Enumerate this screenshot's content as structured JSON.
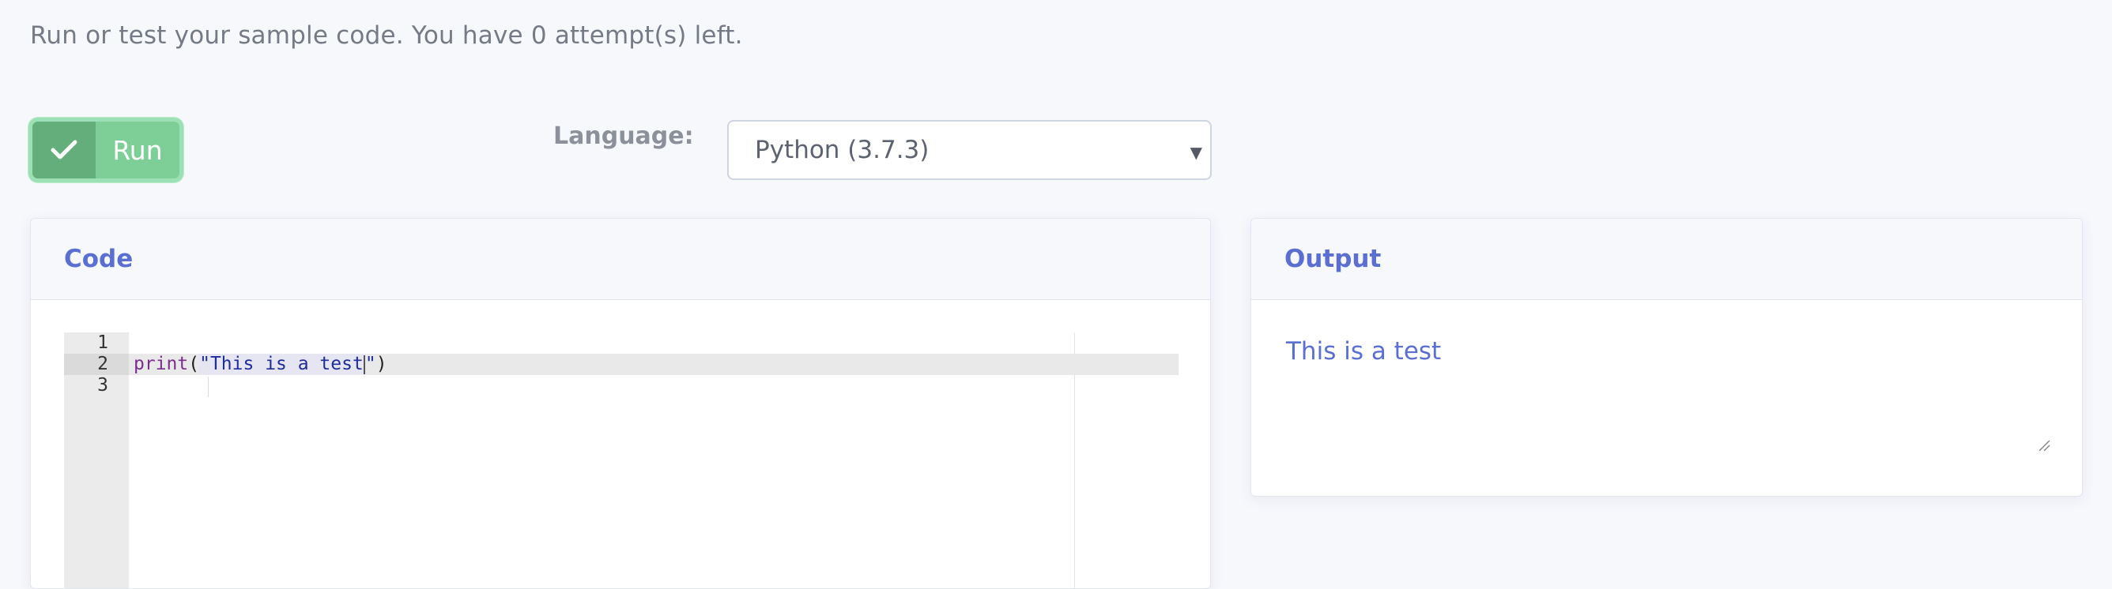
{
  "info": {
    "text": "Run or test your sample code. You have 0 attempt(s) left."
  },
  "toolbar": {
    "run_label": "Run",
    "language_label": "Language:",
    "language_selected": "Python (3.7.3)"
  },
  "code_panel": {
    "title": "Code",
    "line_numbers": [
      "1",
      "2",
      "3"
    ],
    "line2": {
      "func": "print",
      "open": "(",
      "string_part1": "\"This is a test",
      "string_part2": "\"",
      "close": ")"
    }
  },
  "output_panel": {
    "title": "Output",
    "text": "This is a test"
  },
  "colors": {
    "accent": "#5a6fd1",
    "run_button": "#7ecf97",
    "run_icon_bg": "#63ae7b"
  },
  "icons": {
    "run": "check-icon",
    "select": "caret-down-icon",
    "resize": "resize-grip-icon"
  }
}
